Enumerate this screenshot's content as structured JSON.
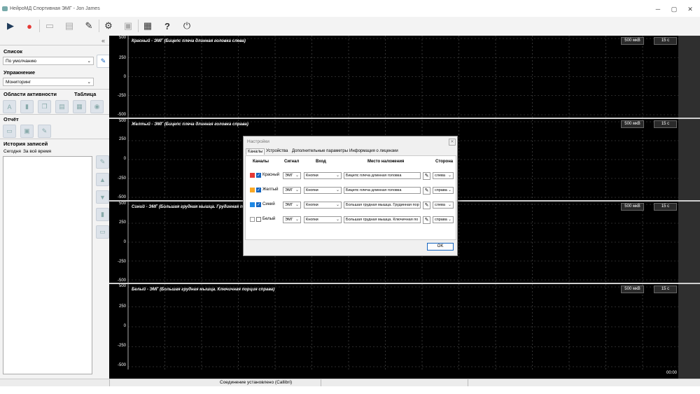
{
  "window": {
    "title": "НейроМД Спортивная ЭМГ - Jon James",
    "controls": [
      "─",
      "▢",
      "✕"
    ]
  },
  "toolbar": [
    {
      "name": "play-icon",
      "glyph": "▶"
    },
    {
      "name": "record-icon",
      "glyph": "●"
    },
    {
      "name": "playback-icon",
      "glyph": "▭"
    },
    {
      "name": "report-icon",
      "glyph": "▤"
    },
    {
      "name": "edit-icon",
      "glyph": "✎"
    },
    {
      "name": "gear-icon",
      "glyph": "⚙"
    },
    {
      "name": "calibrate-icon",
      "glyph": "▣"
    },
    {
      "name": "table-icon",
      "glyph": "▦"
    },
    {
      "name": "help-icon",
      "glyph": "?"
    },
    {
      "name": "power-icon",
      "glyph": "⏻"
    }
  ],
  "left": {
    "collapse": "«",
    "list_label": "Список",
    "list_value": "По умолчанию",
    "exercise_label": "Упражнение",
    "exercise_value": "Мониторинг",
    "areas_label": "Области активности",
    "table_label": "Таблица",
    "report_label": "Отчёт",
    "history_label": "История записей",
    "history_tabs": [
      "Сегодня",
      "За всё время"
    ]
  },
  "plot": {
    "panes": [
      {
        "title": "Красный - ЭМГ (Бицепс плеча длинная головка слева)",
        "scale": "500 мкВ",
        "time": "15 с"
      },
      {
        "title": "Желтый - ЭМГ (Бицепс плеча длинная головка справа)",
        "scale": "500 мкВ",
        "time": "15 с"
      },
      {
        "title": "Синий - ЭМГ (Большая грудная мышца. Грудинная порция слева)",
        "scale": "500 мкВ",
        "time": "15 с"
      },
      {
        "title": "Белый - ЭМГ (Большая грудная мышца. Ключичная порция справа)",
        "scale": "500 мкВ",
        "time": "15 с"
      }
    ],
    "yticks": [
      "500",
      "250",
      "0",
      "-250",
      "-500"
    ],
    "time_label": "00:00"
  },
  "status": {
    "text": "Соединение установлено (Callibri)"
  },
  "dialog": {
    "title": "Настройки",
    "tabs": [
      "Каналы",
      "Устройства",
      "Дополнительные параметры",
      "Информация о лицензии"
    ],
    "headers": {
      "channels": "Каналы",
      "signal": "Сигнал",
      "input": "Вход",
      "placement": "Место наложения",
      "side": "Сторона"
    },
    "rows": [
      {
        "name": "Красный",
        "color": "#e53935",
        "checked": true,
        "signal": "ЭМГ",
        "input": "Кнопки",
        "placement": "Бицепс плеча длинная головка",
        "side": "слева"
      },
      {
        "name": "Желтый",
        "color": "#f9a825",
        "checked": true,
        "signal": "ЭМГ",
        "input": "Кнопки",
        "placement": "Бицепс плеча длинная головка",
        "side": "справа"
      },
      {
        "name": "Синий",
        "color": "#1e88e5",
        "checked": true,
        "signal": "ЭМГ",
        "input": "Кнопки",
        "placement": "Большая грудная мышца. Грудинная пор",
        "side": "слева"
      },
      {
        "name": "Белый",
        "color": "#ffffff",
        "checked": false,
        "signal": "ЭМГ",
        "input": "Кнопки",
        "placement": "Большая грудная мышца. Ключичная по",
        "side": "справа"
      }
    ],
    "ok_label": "OK"
  }
}
